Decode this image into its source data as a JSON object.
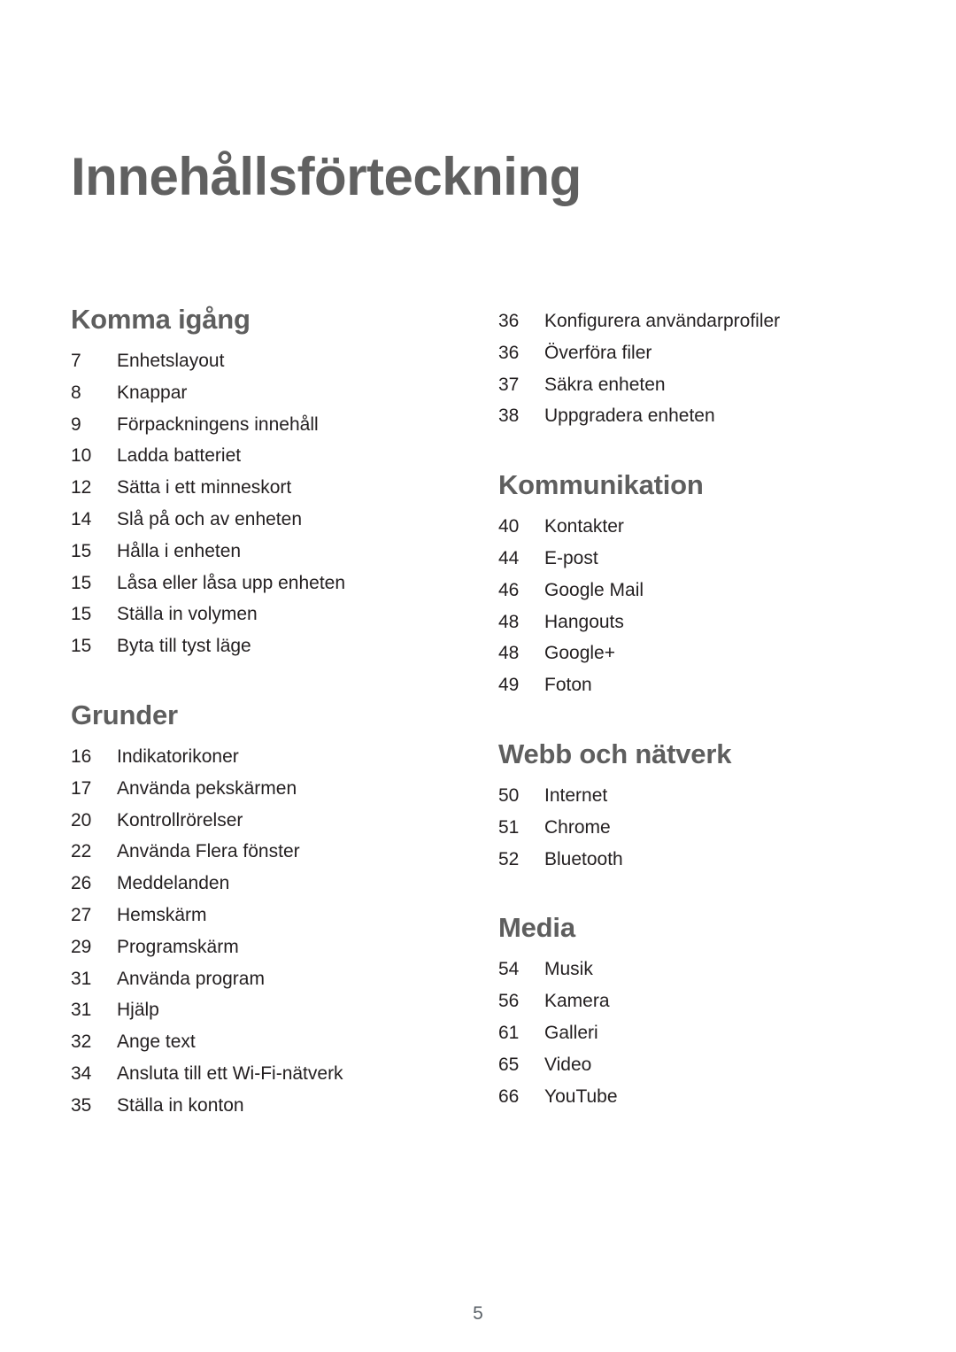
{
  "document": {
    "title": "Innehållsförteckning",
    "page_number": "5",
    "colors": {
      "title": "#606060",
      "section_heading": "#5e5e5e",
      "body_text": "#231f20",
      "folio": "#5b6268",
      "background": "#ffffff"
    }
  },
  "left_column": {
    "sections": [
      {
        "heading": "Komma igång",
        "entries": [
          {
            "page": "7",
            "label": "Enhetslayout"
          },
          {
            "page": "8",
            "label": "Knappar"
          },
          {
            "page": "9",
            "label": "Förpackningens innehåll"
          },
          {
            "page": "10",
            "label": "Ladda batteriet"
          },
          {
            "page": "12",
            "label": "Sätta i ett minneskort"
          },
          {
            "page": "14",
            "label": "Slå på och av enheten"
          },
          {
            "page": "15",
            "label": "Hålla i enheten"
          },
          {
            "page": "15",
            "label": "Låsa eller låsa upp enheten"
          },
          {
            "page": "15",
            "label": "Ställa in volymen"
          },
          {
            "page": "15",
            "label": "Byta till tyst läge"
          }
        ]
      },
      {
        "heading": "Grunder",
        "entries": [
          {
            "page": "16",
            "label": "Indikatorikoner"
          },
          {
            "page": "17",
            "label": "Använda pekskärmen"
          },
          {
            "page": "20",
            "label": "Kontrollrörelser"
          },
          {
            "page": "22",
            "label": "Använda Flera fönster"
          },
          {
            "page": "26",
            "label": "Meddelanden"
          },
          {
            "page": "27",
            "label": "Hemskärm"
          },
          {
            "page": "29",
            "label": "Programskärm"
          },
          {
            "page": "31",
            "label": "Använda program"
          },
          {
            "page": "31",
            "label": "Hjälp"
          },
          {
            "page": "32",
            "label": "Ange text"
          },
          {
            "page": "34",
            "label": "Ansluta till ett Wi-Fi-nätverk"
          },
          {
            "page": "35",
            "label": "Ställa in konton"
          }
        ]
      }
    ]
  },
  "right_column": {
    "continuation_entries": [
      {
        "page": "36",
        "label": "Konfigurera användarprofiler"
      },
      {
        "page": "36",
        "label": "Överföra filer"
      },
      {
        "page": "37",
        "label": "Säkra enheten"
      },
      {
        "page": "38",
        "label": "Uppgradera enheten"
      }
    ],
    "sections": [
      {
        "heading": "Kommunikation",
        "entries": [
          {
            "page": "40",
            "label": "Kontakter"
          },
          {
            "page": "44",
            "label": "E-post"
          },
          {
            "page": "46",
            "label": "Google Mail"
          },
          {
            "page": "48",
            "label": "Hangouts"
          },
          {
            "page": "48",
            "label": "Google+"
          },
          {
            "page": "49",
            "label": "Foton"
          }
        ]
      },
      {
        "heading": "Webb och nätverk",
        "entries": [
          {
            "page": "50",
            "label": "Internet"
          },
          {
            "page": "51",
            "label": "Chrome"
          },
          {
            "page": "52",
            "label": "Bluetooth"
          }
        ]
      },
      {
        "heading": "Media",
        "entries": [
          {
            "page": "54",
            "label": "Musik"
          },
          {
            "page": "56",
            "label": "Kamera"
          },
          {
            "page": "61",
            "label": "Galleri"
          },
          {
            "page": "65",
            "label": "Video"
          },
          {
            "page": "66",
            "label": "YouTube"
          }
        ]
      }
    ]
  }
}
